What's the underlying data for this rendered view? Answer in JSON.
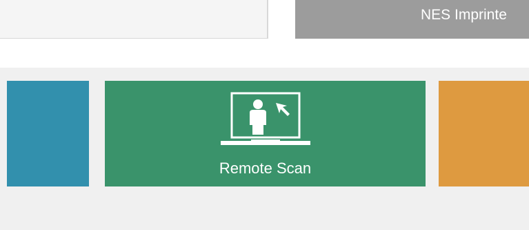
{
  "header": {
    "printer_name": "NES Imprinte"
  },
  "tiles": {
    "remote_scan": {
      "label": "Remote Scan",
      "icon": "remote-scan-icon"
    }
  },
  "colors": {
    "tile_blue": "#3290ad",
    "tile_green": "#3a936b",
    "tile_orange": "#de9a40",
    "printer_bar": "#9c9c9c"
  }
}
